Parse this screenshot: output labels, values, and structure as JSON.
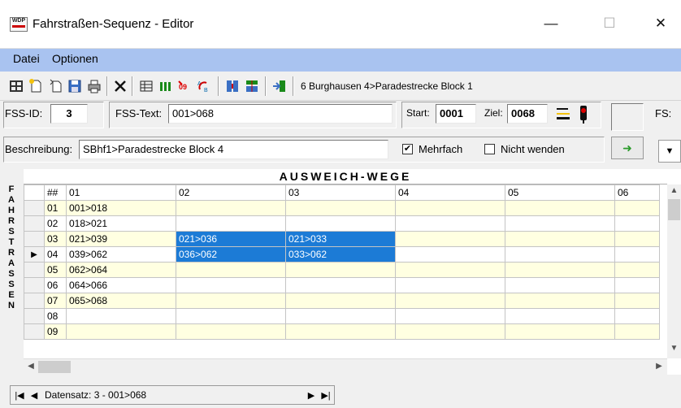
{
  "window": {
    "title": "Fahrstraßen-Sequenz - Editor",
    "icon_text": "WDP",
    "min_glyph": "—",
    "max_glyph": "☐",
    "close_glyph": "✕"
  },
  "menu": [
    {
      "label": "Datei",
      "underline": "D"
    },
    {
      "label": "Optionen",
      "underline": "O"
    }
  ],
  "toolbar": {
    "icons": [
      "move-icon",
      "new-icon",
      "copy-icon",
      "save-icon",
      "print-icon",
      "delete-icon",
      "grid-icon",
      "chart-icon",
      "record-icon",
      "swap-icon",
      "split-icon",
      "merge-icon",
      "export-icon"
    ],
    "caption": "6 Burghausen 4>Paradestrecke Block 1"
  },
  "fss": {
    "id_label": "FSS-ID:",
    "id_value": "3",
    "text_label": "FSS-Text:",
    "text_value": "001>068",
    "start_label": "Start:",
    "start_value": "0001",
    "ziel_label": "Ziel:",
    "ziel_value": "0068",
    "fs_label": "FS:"
  },
  "beschreibung": {
    "label": "Beschreibung:",
    "value": "SBhf1>Paradestrecke Block 4",
    "mehrfach_label": "Mehrfach",
    "mehrfach_checked": true,
    "nicht_wenden_label": "Nicht wenden",
    "nicht_wenden_checked": false
  },
  "grid": {
    "title": "AUSWEICH-WEGE",
    "side_label": [
      "F",
      "A",
      "H",
      "R",
      "S",
      "T",
      "R",
      "A",
      "S",
      "S",
      "E",
      "N"
    ],
    "headers": [
      "##",
      "01",
      "02",
      "03",
      "04",
      "05",
      "06"
    ],
    "rows": [
      {
        "num": "01",
        "cells": [
          "001>018",
          "",
          "",
          "",
          "",
          ""
        ],
        "style": "yel"
      },
      {
        "num": "02",
        "cells": [
          "018>021",
          "",
          "",
          "",
          "",
          ""
        ],
        "style": "wht"
      },
      {
        "num": "03",
        "cells": [
          "021>039",
          "021>036",
          "021>033",
          "",
          "",
          ""
        ],
        "style": "yel"
      },
      {
        "num": "04",
        "cells": [
          "039>062",
          "036>062",
          "033>062",
          "",
          "",
          ""
        ],
        "style": "wht",
        "current": true
      },
      {
        "num": "05",
        "cells": [
          "062>064",
          "",
          "",
          "",
          "",
          ""
        ],
        "style": "yel"
      },
      {
        "num": "06",
        "cells": [
          "064>066",
          "",
          "",
          "",
          "",
          ""
        ],
        "style": "wht"
      },
      {
        "num": "07",
        "cells": [
          "065>068",
          "",
          "",
          "",
          "",
          ""
        ],
        "style": "yel"
      },
      {
        "num": "08",
        "cells": [
          "",
          "",
          "",
          "",
          "",
          ""
        ],
        "style": "wht"
      },
      {
        "num": "09",
        "cells": [
          "",
          "",
          "",
          "",
          "",
          ""
        ],
        "style": "yel"
      }
    ],
    "selected_cells": [
      [
        2,
        1
      ],
      [
        2,
        2
      ],
      [
        3,
        1
      ],
      [
        3,
        2
      ]
    ]
  },
  "navigator": {
    "first_glyph": "|◀",
    "prev_glyph": "◀",
    "next_glyph": "▶",
    "last_glyph": "▶|",
    "record_text": "Datensatz: 3 - 001>068"
  },
  "colors": {
    "menubar": "#a9c3f0",
    "row_yellow": "#ffffe1",
    "selection": "#1c7bd6"
  }
}
